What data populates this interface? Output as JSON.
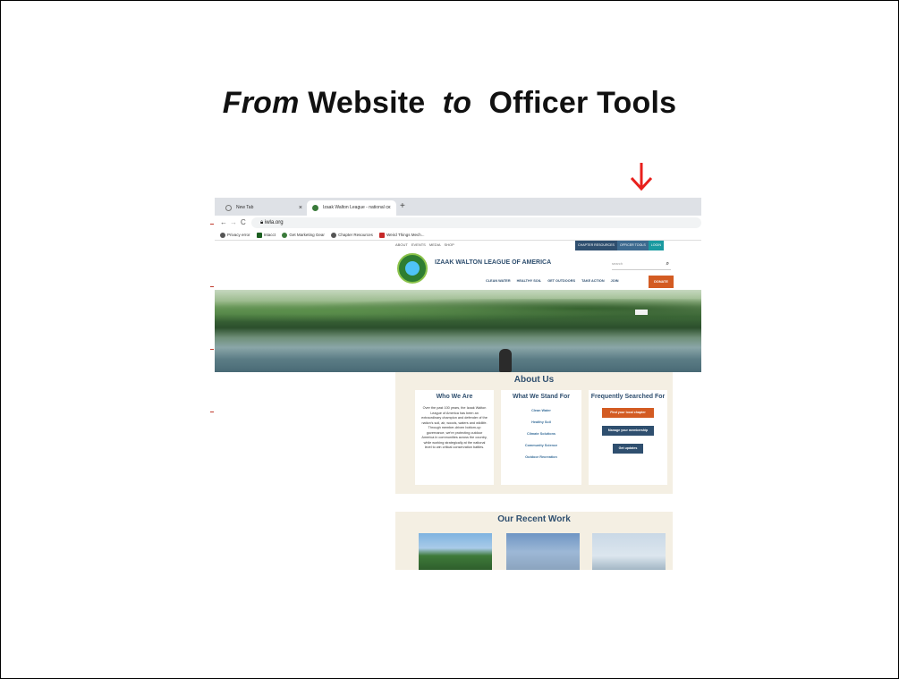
{
  "slide": {
    "title_from": "From",
    "title_website": "Website",
    "title_to": "to",
    "title_officer": "Officer Tools"
  },
  "colors": {
    "arrow": "#e8201c",
    "brand_navy": "#2f4f6f",
    "donate_orange": "#d35b22"
  },
  "browser": {
    "tabs": [
      {
        "label": "New Tab",
        "icon": "search-icon"
      },
      {
        "label": "Izaak Walton League - national c",
        "icon": "site-favicon"
      }
    ],
    "new_tab": "+",
    "url": "iwla.org",
    "bookmarks": [
      "Privacy error",
      "Intacct",
      "Get Marketing Gear",
      "Chapter Resources",
      "Weird Things Mech..."
    ]
  },
  "site": {
    "util_links": "ABOUT EVENTS MEDIA SHOP",
    "util_buttons": [
      "CHAPTER RESOURCES",
      "OFFICER TOOLS",
      "LOGIN"
    ],
    "org_name": "IZAAK WALTON LEAGUE OF AMERICA",
    "search_placeholder": "search",
    "nav": [
      "CLEAN WATER",
      "HEALTHY SOIL",
      "GET OUTDOORS",
      "TAKE ACTION",
      "JOIN"
    ],
    "donate": "DONATE",
    "about_heading": "About Us",
    "who_heading": "Who We Are",
    "who_text": "Over the past 100 years, the Izaak Walton League of America has been an extraordinary champion and defender of the nation's soil, air, woods, waters and wildlife. Through member-driven bottom-up governance, we're protecting outdoor America in communities across the country, while working strategically at the national level to win critical conservation battles.",
    "stand_heading": "What We Stand For",
    "stand_links": [
      "Clean Water",
      "Healthy Soil",
      "Climate Solutions",
      "Community Science",
      "Outdoor Recreation"
    ],
    "freq_heading": "Frequently Searched For",
    "freq_buttons": [
      "Find your local chapter",
      "Manage your membership",
      "Get updates"
    ],
    "recent_heading": "Our Recent Work"
  }
}
